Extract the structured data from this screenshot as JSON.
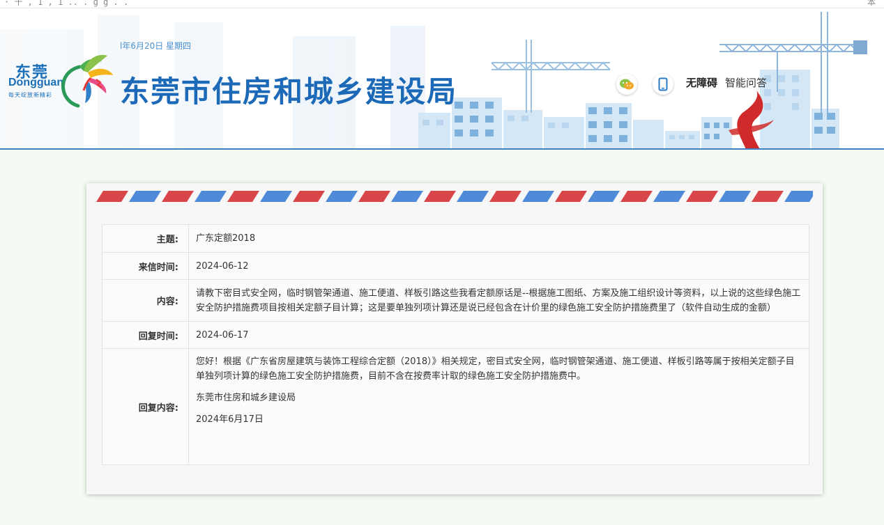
{
  "browser": {
    "url_fragment": "· 十 , 1 , 1 .. . g g . .",
    "right_fragment": "本"
  },
  "header": {
    "date_text": "l年6月20日 星期四",
    "site_title": "东莞市住房和城乡建设局",
    "logo": {
      "cn": "东莞",
      "en": "Dongguan",
      "slogan": "每天绽放新精彩"
    },
    "tools": {
      "wechat_icon": "wechat-icon",
      "mobile_icon": "mobile-icon",
      "accessibility_label": "无障碍",
      "qa_label": "智能问答"
    },
    "colors": {
      "title": "#1c69b8",
      "underline": "#3d7fc0",
      "buildings": "#cfe3f4"
    }
  },
  "letter": {
    "rows": {
      "subject": {
        "label": "主题:",
        "value": "广东定额2018"
      },
      "sent_date": {
        "label": "来信时间:",
        "value": "2024-06-12"
      },
      "content": {
        "label": "内容:",
        "value": "请教下密目式安全网，临时钢管架通道、施工便道、样板引路这些我看定额原话是--根据施工图纸、方案及施工组织设计等资料，以上说的这些绿色施工安全防护措施费项目按相关定额子目计算；这是要单独列项计算还是说已经包含在计价里的绿色施工安全防护措施费里了（软件自动生成的金额）"
      },
      "reply_date": {
        "label": "回复时间:",
        "value": "2024-06-17"
      },
      "reply": {
        "label": "回复内容:",
        "paragraph": "您好！根据《广东省房屋建筑与装饰工程综合定额（2018）》相关规定，密目式安全网，临时钢管架通道、施工便道、样板引路等属于按相关定额子目单独列项计算的绿色施工安全防护措施费，目前不含在按费率计取的绿色施工安全防护措施费中。",
        "signature": "东莞市住房和城乡建设局",
        "date": "2024年6月17日"
      }
    },
    "colors": {
      "airmail_red": "#d9464a",
      "airmail_blue": "#4f8ad8",
      "background": "#f3fbf2"
    }
  }
}
